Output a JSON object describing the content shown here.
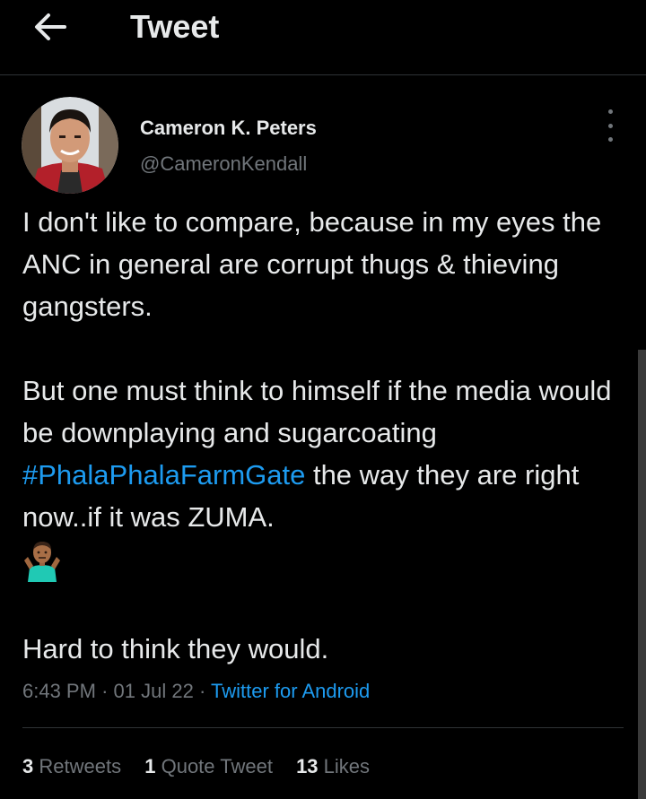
{
  "header": {
    "title": "Tweet",
    "back_icon": "arrow-left-icon"
  },
  "author": {
    "display_name": "Cameron K. Peters",
    "handle": "@CameronKendall",
    "avatar_icon": "avatar"
  },
  "tweet": {
    "paragraph1": "I don't like to compare, because in my eyes the ANC in general are corrupt thugs & thieving gangsters.",
    "paragraph2_before": "But one must think to himself if the media would be downplaying and sugarcoating ",
    "hashtag": "#PhalaPhalaFarmGate",
    "paragraph2_after": " the way they are right now..if it was ZUMA.",
    "emoji_icon": "person-shrugging-emoji",
    "paragraph3": "Hard to think they would."
  },
  "meta": {
    "time": "6:43 PM",
    "date": "01 Jul 22",
    "source": "Twitter for Android",
    "separator": "·"
  },
  "stats": {
    "retweets_count": "3",
    "retweets_label": "Retweets",
    "quotes_count": "1",
    "quotes_label": "Quote Tweet",
    "likes_count": "13",
    "likes_label": "Likes"
  },
  "colors": {
    "background": "#000000",
    "text": "#e7e9ea",
    "secondary_text": "#71767b",
    "link": "#1d9bf0",
    "divider": "#2f3336"
  }
}
